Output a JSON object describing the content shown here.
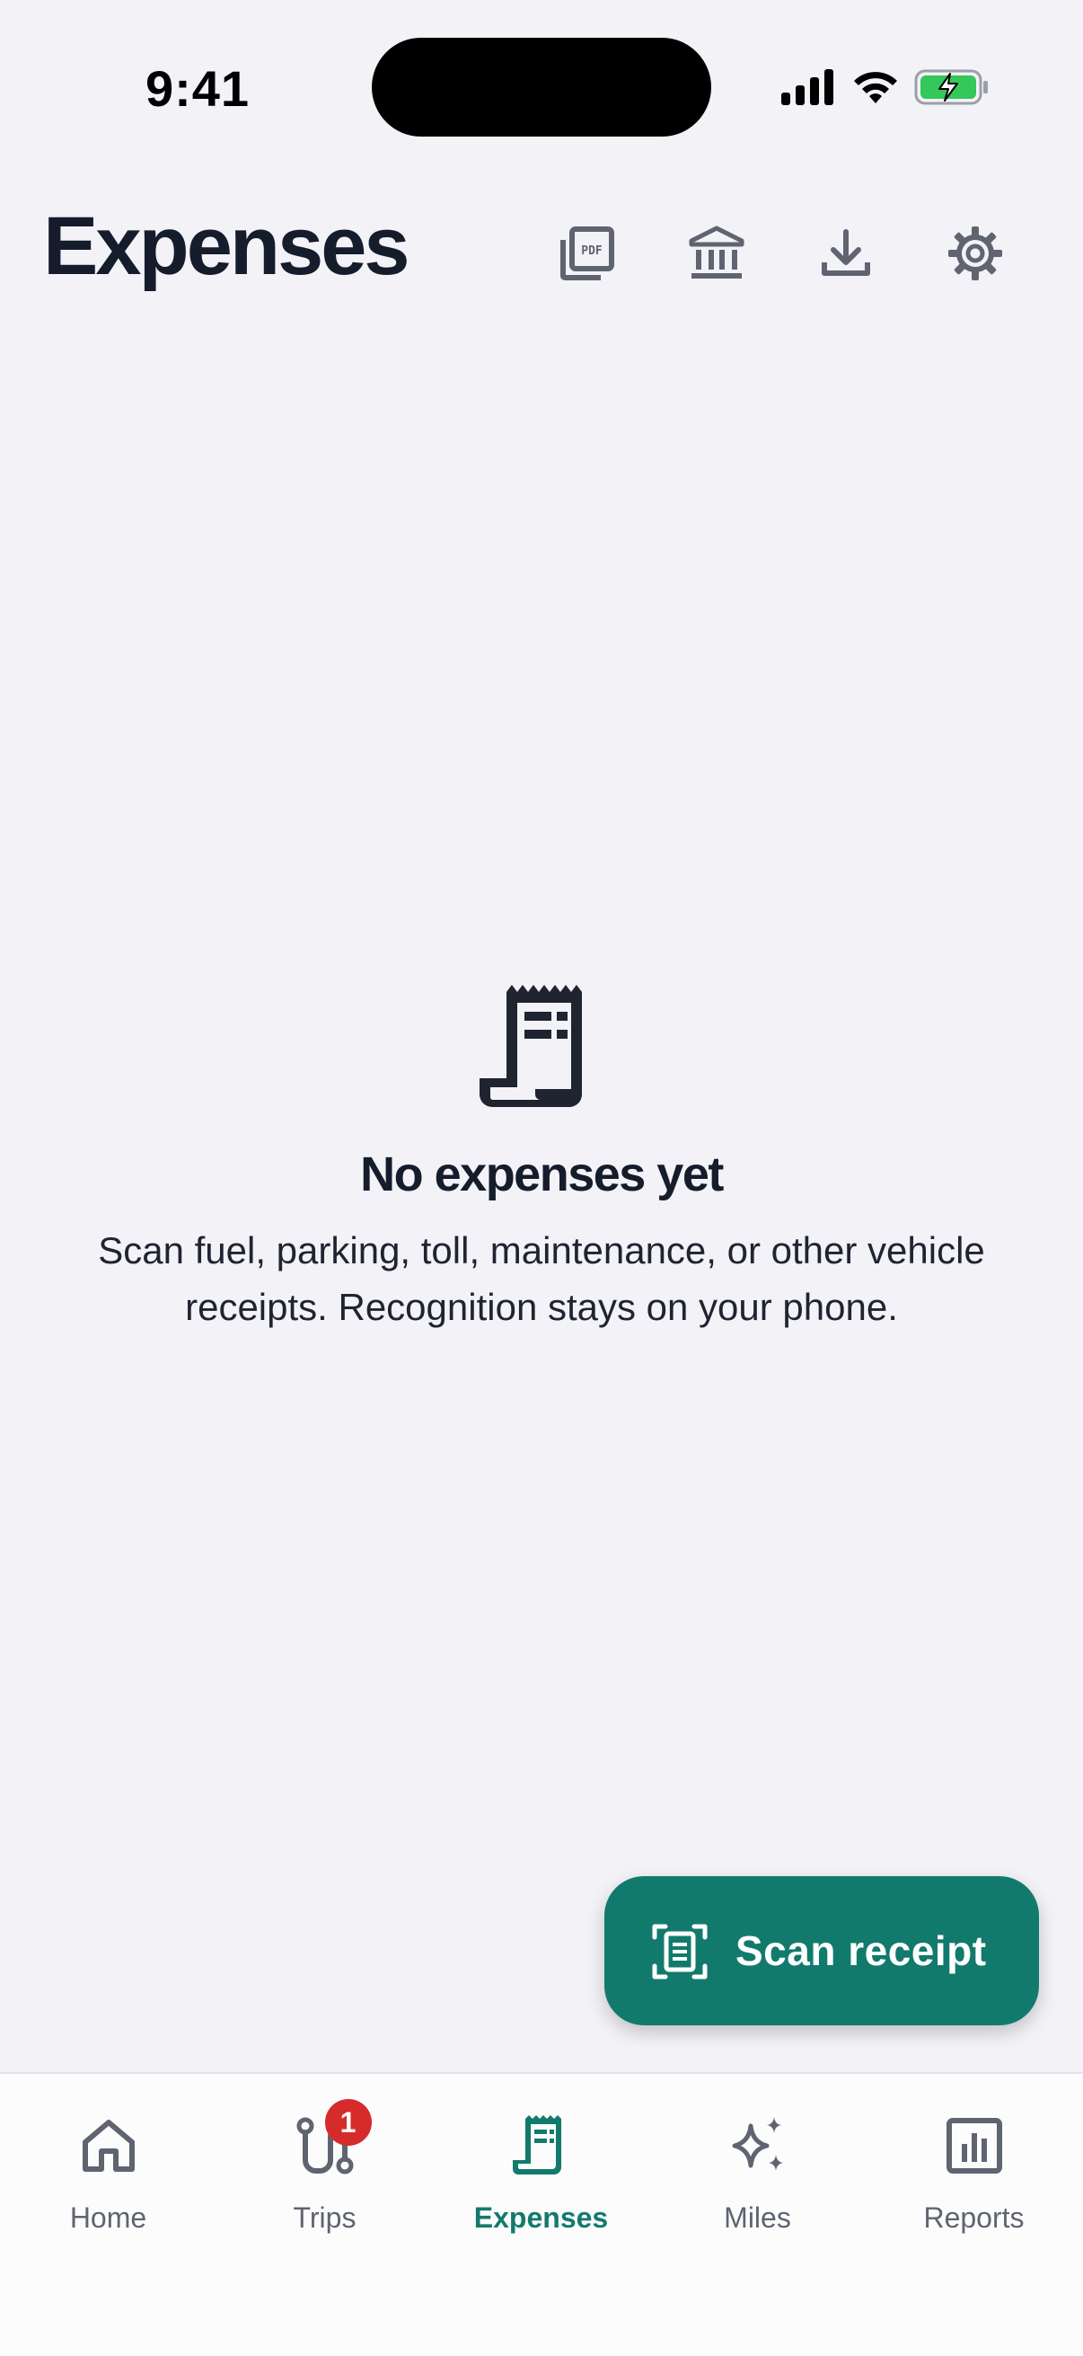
{
  "status_bar": {
    "time": "9:41"
  },
  "header": {
    "title": "Expenses",
    "actions": [
      {
        "icon": "pdf-icon"
      },
      {
        "icon": "bank-icon"
      },
      {
        "icon": "download-icon"
      },
      {
        "icon": "gear-icon"
      }
    ]
  },
  "empty_state": {
    "icon": "receipt-icon",
    "title": "No expenses yet",
    "description": "Scan fuel, parking, toll, maintenance, or other vehicle receipts. Recognition stays on your phone."
  },
  "fab": {
    "label": "Scan receipt",
    "icon": "scan-document-icon"
  },
  "tab_bar": {
    "active_color": "#127a6d",
    "items": [
      {
        "label": "Home",
        "icon": "home-icon"
      },
      {
        "label": "Trips",
        "icon": "route-icon",
        "badge": "1"
      },
      {
        "label": "Expenses",
        "icon": "receipt-icon",
        "active": true
      },
      {
        "label": "Miles",
        "icon": "sparkles-icon"
      },
      {
        "label": "Reports",
        "icon": "bar-chart-icon"
      }
    ]
  }
}
